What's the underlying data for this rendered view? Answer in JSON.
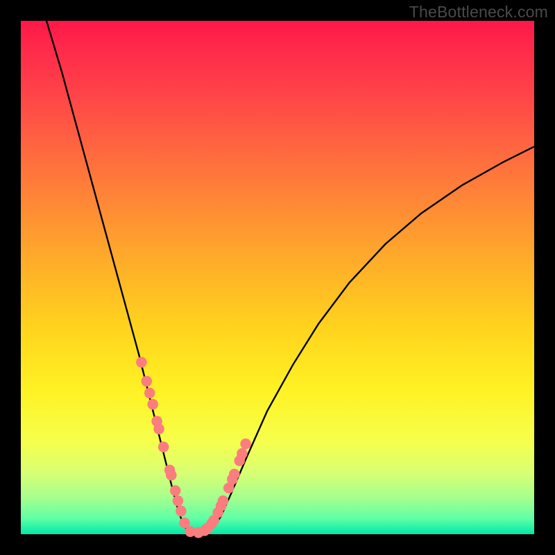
{
  "watermark": "TheBottleneck.com",
  "chart_data": {
    "type": "line",
    "title": "",
    "xlabel": "",
    "ylabel": "",
    "xlim": [
      0,
      100
    ],
    "ylim": [
      0,
      100
    ],
    "legend": false,
    "grid": false,
    "background": "rainbow-gradient",
    "series": [
      {
        "name": "left-curve",
        "kind": "line",
        "color": "#000000",
        "x": [
          5,
          8,
          11,
          14,
          17,
          20,
          23,
          25,
          26.5,
          28,
          29.5,
          30.7,
          31.8
        ],
        "y": [
          100,
          90,
          79,
          68,
          57,
          46,
          35,
          27,
          21,
          15,
          9,
          4.5,
          1.5
        ]
      },
      {
        "name": "valley-floor",
        "kind": "line",
        "color": "#000000",
        "x": [
          31.8,
          33,
          34.5,
          36,
          37.5
        ],
        "y": [
          1.5,
          0.3,
          0.0,
          0.3,
          1.3
        ]
      },
      {
        "name": "right-curve",
        "kind": "line",
        "color": "#000000",
        "x": [
          37.5,
          39,
          41,
          44,
          48,
          53,
          58,
          64,
          71,
          78,
          86,
          94,
          100
        ],
        "y": [
          1.3,
          3.5,
          8,
          15,
          24,
          33,
          41,
          49,
          56.5,
          62.5,
          68,
          72.5,
          75.5
        ]
      },
      {
        "name": "highlight-dots",
        "kind": "scatter",
        "color": "#fc7d7e",
        "x": [
          23.5,
          24.5,
          25.1,
          25.7,
          26.5,
          26.9,
          27.8,
          29.0,
          29.3,
          30.1,
          30.6,
          31.2,
          31.9,
          33.0,
          34.6,
          35.8,
          36.4,
          37.2,
          37.6,
          38.4,
          39.0,
          39.4,
          40.5,
          41.2,
          41.6,
          42.6,
          43.1,
          43.8
        ],
        "y": [
          33.5,
          29.8,
          27.5,
          25.3,
          22.0,
          20.5,
          17.0,
          12.5,
          11.5,
          8.5,
          6.5,
          4.5,
          2.2,
          0.5,
          0.3,
          0.7,
          1.2,
          2.1,
          2.7,
          4.2,
          5.5,
          6.5,
          9.0,
          10.7,
          11.7,
          14.3,
          15.7,
          17.6
        ]
      }
    ]
  }
}
